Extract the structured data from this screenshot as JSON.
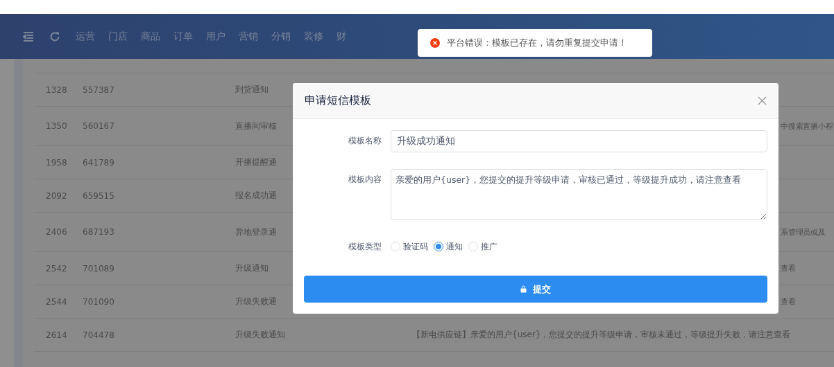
{
  "nav": {
    "items": [
      "运营",
      "门店",
      "商品",
      "订单",
      "用户",
      "营销",
      "分销",
      "装修",
      "财"
    ]
  },
  "toast": {
    "kind": "error",
    "message": "平台错误：模板已存在，请勿重复提交申请！"
  },
  "table": {
    "rows": [
      {
        "id": "1328",
        "code": "557387",
        "name": "到货通知"
      },
      {
        "id": "1350",
        "code": "560167",
        "name": "直播间审核",
        "tail": "中搜索直播小程"
      },
      {
        "id": "1958",
        "code": "641789",
        "name": "开播提醒通"
      },
      {
        "id": "2092",
        "code": "659515",
        "name": "报名成功通"
      },
      {
        "id": "2406",
        "code": "687193",
        "name": "异地登录通",
        "tail": "系管理员或及"
      },
      {
        "id": "2542",
        "code": "701089",
        "name": "升级通知",
        "tail": "查看"
      },
      {
        "id": "2544",
        "code": "701090",
        "name": "升级失败通",
        "tail": "查看"
      },
      {
        "id": "2614",
        "code": "704478",
        "name": "升级失败通知",
        "content": "【新电供应链】亲爱的用户{user}，您提交的提升等级申请，审核未通过，等级提升失败，请注意查看"
      }
    ]
  },
  "dialog": {
    "title": "申请短信模板",
    "name_label": "模板名称",
    "name_value": "升级成功通知",
    "content_label": "模板内容",
    "content_value": "亲爱的用户{user}，您提交的提升等级申请，审核已通过，等级提升成功，请注意查看",
    "type_label": "模板类型",
    "types": [
      {
        "label": "验证码",
        "selected": false
      },
      {
        "label": "通知",
        "selected": true
      },
      {
        "label": "推广",
        "selected": false
      }
    ],
    "submit": "提交"
  }
}
